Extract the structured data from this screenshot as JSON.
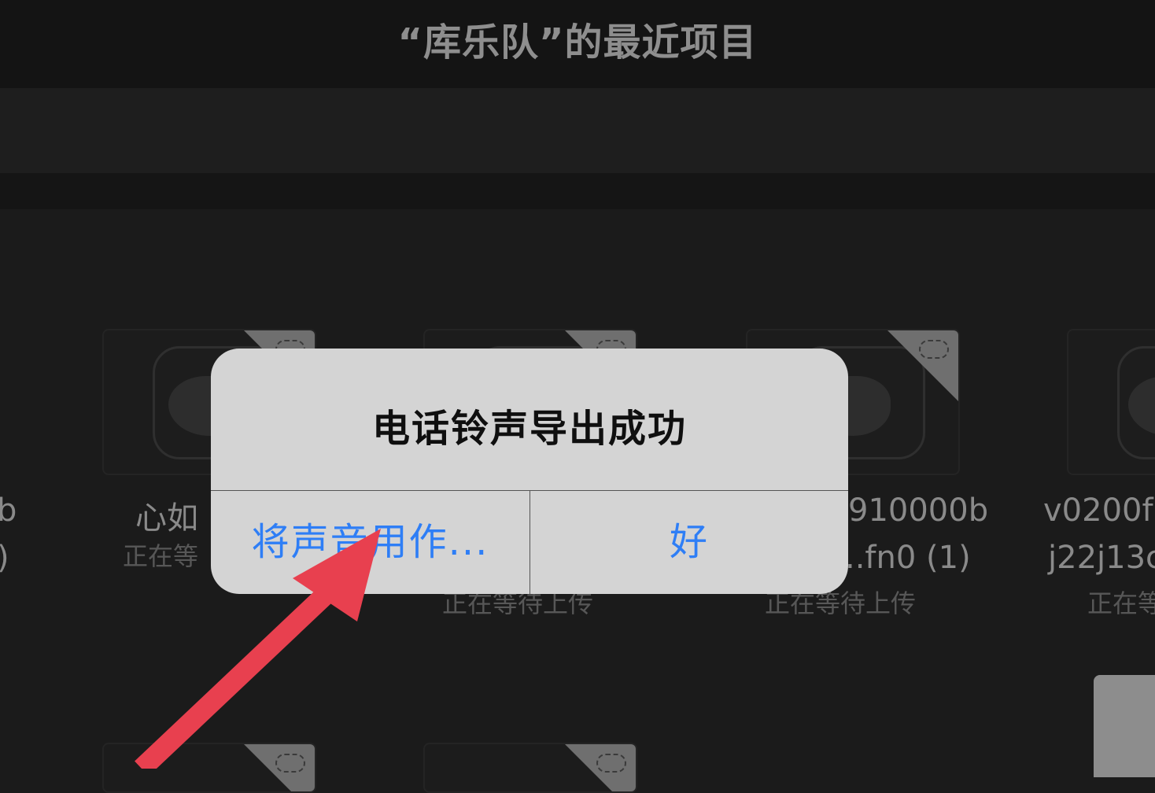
{
  "header": {
    "title": "“库乐队”的最近项目"
  },
  "projects": [
    {
      "name": "b",
      "extra": ")",
      "status": ""
    },
    {
      "name": "心如",
      "status": "正在等"
    },
    {
      "name": "",
      "status": "正在等待上传"
    },
    {
      "name": "910000b",
      "extra": "..fn0 (1)",
      "status": "正在等待上传"
    },
    {
      "name": "v0200f",
      "extra": "j22j13c",
      "status": "正在等"
    }
  ],
  "dialog": {
    "title": "电话铃声导出成功",
    "use_sound_as_label": "将声音用作...",
    "ok_label": "好"
  },
  "colors": {
    "accent": "#2e7ef6",
    "arrow": "#e8404f"
  }
}
